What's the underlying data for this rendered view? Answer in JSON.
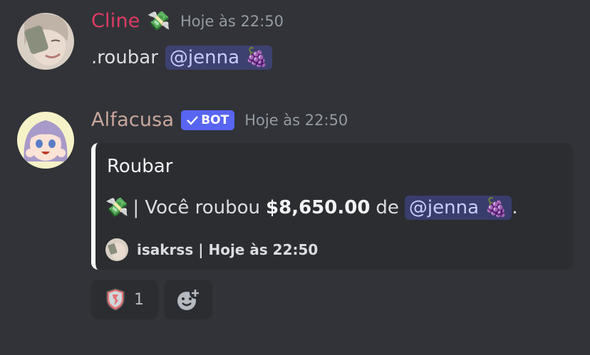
{
  "messages": [
    {
      "username": "Cline",
      "username_color": "#e03b65",
      "badge_emoji": "💸",
      "timestamp": "Hoje às 22:50",
      "text_prefix": ".roubar",
      "mention": "@jenna",
      "mention_emoji": "🍇"
    },
    {
      "username": "Alfacusa",
      "username_color": "#c9a79b",
      "bot_badge": "BOT",
      "timestamp": "Hoje às 22:50",
      "embed": {
        "title": "Roubar",
        "desc_emoji": "💸",
        "desc_prefix": "| Você roubou",
        "amount": "$8,650.00",
        "desc_middle": "de",
        "mention": "@jenna",
        "mention_emoji": "🍇",
        "desc_suffix": ".",
        "footer": "isakrss | Hoje às 22:50"
      },
      "reactions": [
        {
          "icon": "shield-emoji",
          "count": "1"
        },
        {
          "icon": "add-reaction-icon"
        }
      ]
    }
  ]
}
